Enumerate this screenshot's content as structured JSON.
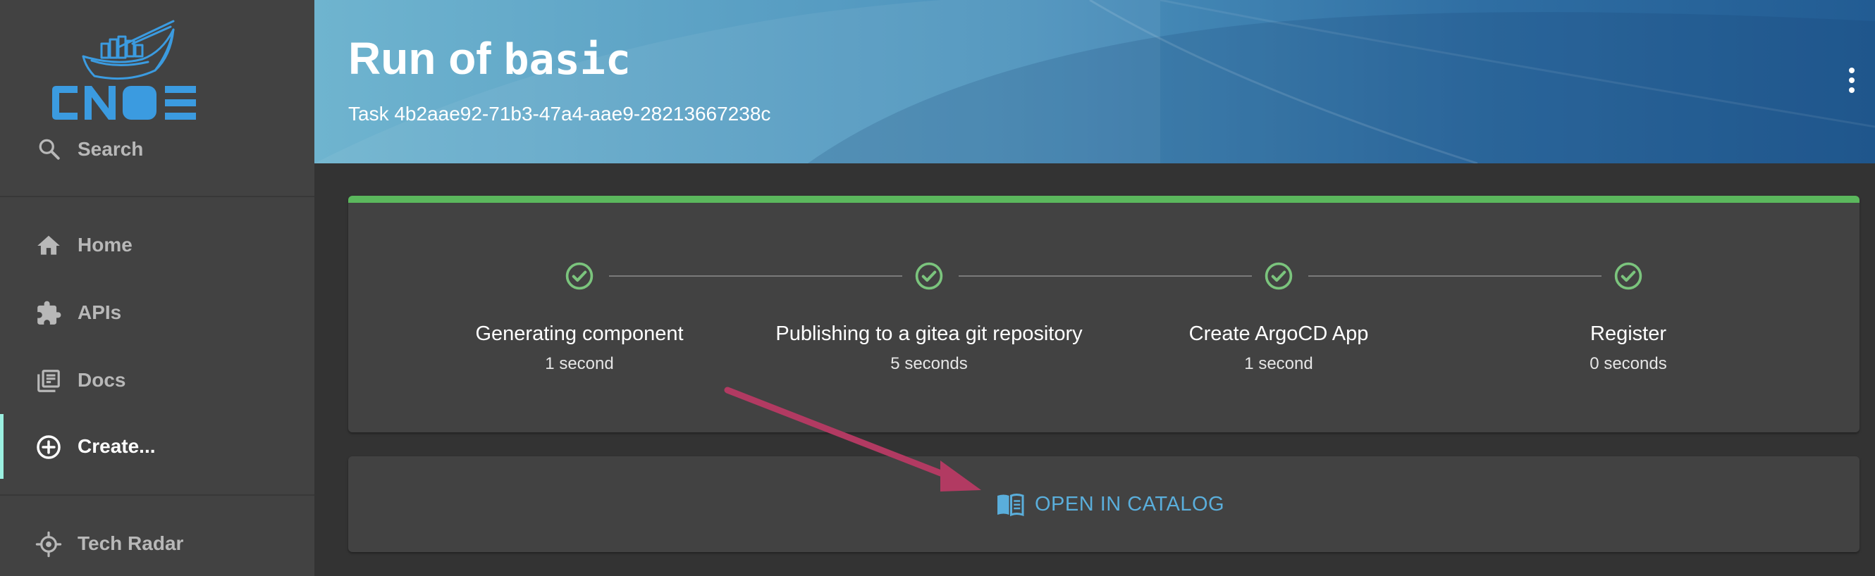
{
  "brand": {
    "logo_text": "CNOE",
    "accent": "#3b9be0"
  },
  "sidebar": {
    "search_label": "Search",
    "items": [
      {
        "label": "Home",
        "icon": "home-icon"
      },
      {
        "label": "APIs",
        "icon": "puzzle-icon"
      },
      {
        "label": "Docs",
        "icon": "library-books-icon"
      },
      {
        "label": "Create...",
        "icon": "add-circle-icon",
        "active": true
      },
      {
        "label": "Tech Radar",
        "icon": "radar-icon"
      }
    ],
    "active_indicator_color": "#9bf0e1"
  },
  "header": {
    "title_prefix": "Run of ",
    "title_template": "basic",
    "subtitle": "Task 4b2aae92-71b3-47a4-aae9-28213667238c",
    "menu_icon": "more-vert-icon"
  },
  "steps": {
    "status_color": "#5bb85d",
    "items": [
      {
        "name": "Generating component",
        "duration": "1 second",
        "status": "completed"
      },
      {
        "name": "Publishing to a gitea git repository",
        "duration": "5 seconds",
        "status": "completed"
      },
      {
        "name": "Create ArgoCD App",
        "duration": "1 second",
        "status": "completed"
      },
      {
        "name": "Register",
        "duration": "0 seconds",
        "status": "completed"
      }
    ]
  },
  "actions": {
    "open_catalog_label": "OPEN IN CATALOG",
    "open_catalog_icon": "menu-book-icon",
    "link_color": "#5aaedb"
  },
  "annotation": {
    "type": "arrow",
    "color": "#b23a62"
  }
}
